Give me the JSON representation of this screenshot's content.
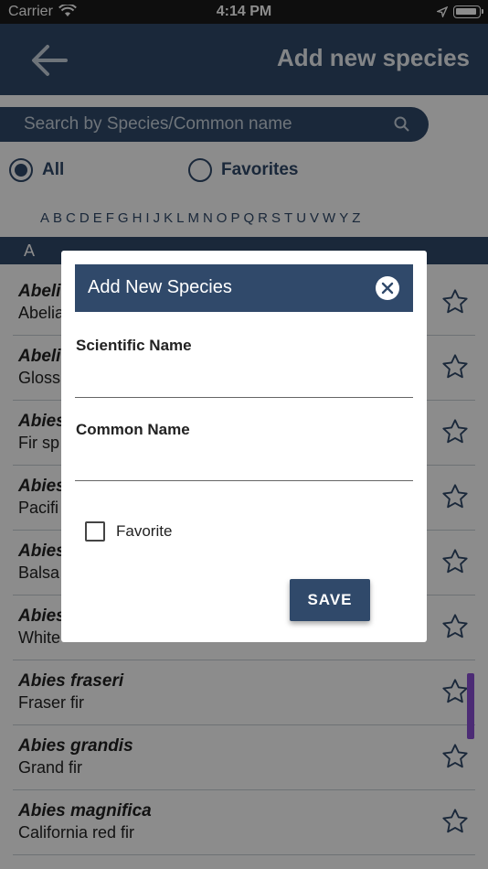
{
  "status_bar": {
    "carrier": "Carrier",
    "time": "4:14 PM"
  },
  "header": {
    "title": "Add new species",
    "back_icon": "arrow-left-icon"
  },
  "search": {
    "placeholder": "Search by Species/Common name",
    "icon": "search-icon"
  },
  "filters": [
    {
      "label": "All",
      "selected": true
    },
    {
      "label": "Favorites",
      "selected": false
    }
  ],
  "alphabet": [
    "A",
    "B",
    "C",
    "D",
    "E",
    "F",
    "G",
    "H",
    "I",
    "J",
    "K",
    "L",
    "M",
    "N",
    "O",
    "P",
    "Q",
    "R",
    "S",
    "T",
    "U",
    "V",
    "W",
    "Y",
    "Z"
  ],
  "section_letter": "A",
  "species": [
    {
      "scientific": "Abeli",
      "common": "Abelia"
    },
    {
      "scientific": "Abeli",
      "common": "Gloss"
    },
    {
      "scientific": "Abies",
      "common": "Fir sp"
    },
    {
      "scientific": "Abies",
      "common": "Pacifi"
    },
    {
      "scientific": "Abies",
      "common": "Balsa"
    },
    {
      "scientific": "Abies",
      "common": "White"
    },
    {
      "scientific": "Abies fraseri",
      "common": "Fraser fir"
    },
    {
      "scientific": "Abies grandis",
      "common": "Grand fir"
    },
    {
      "scientific": "Abies magnifica",
      "common": "California red fir"
    }
  ],
  "modal": {
    "title": "Add New Species",
    "scientific_label": "Scientific Name",
    "scientific_value": "",
    "common_label": "Common Name",
    "common_value": "",
    "favorite_label": "Favorite",
    "favorite_checked": false,
    "save_label": "SAVE"
  },
  "colors": {
    "primary": "#30496a",
    "scroll": "#8a4fd6"
  }
}
